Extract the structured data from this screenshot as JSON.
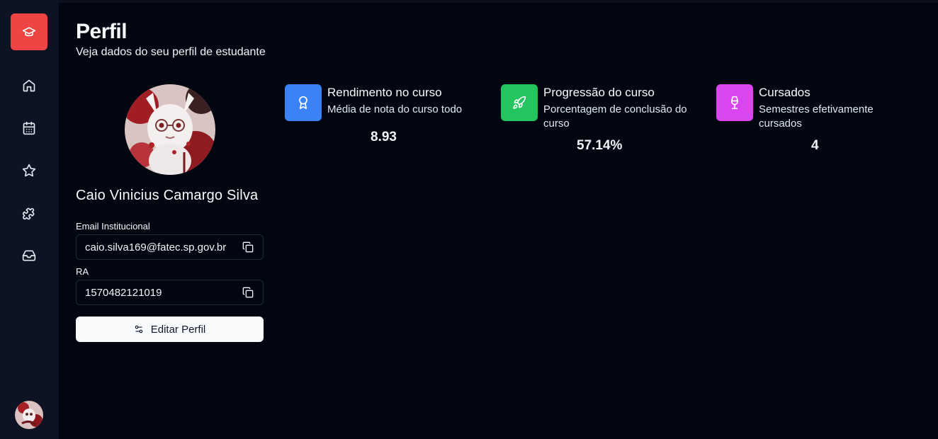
{
  "header": {
    "title": "Perfil",
    "subtitle": "Veja dados do seu perfil de estudante"
  },
  "sidebar": {
    "brand_icon": "graduation-cap-icon",
    "items": [
      {
        "icon": "home-icon"
      },
      {
        "icon": "calendar-icon"
      },
      {
        "icon": "star-icon"
      },
      {
        "icon": "puzzle-icon"
      },
      {
        "icon": "inbox-icon"
      }
    ]
  },
  "profile": {
    "name": "Caio Vinicius Camargo Silva",
    "email_label": "Email Institucional",
    "email": "caio.silva169@fatec.sp.gov.br",
    "ra_label": "RA",
    "ra": "1570482121019",
    "edit_label": "Editar Perfil"
  },
  "stats": [
    {
      "title": "Rendimento no curso",
      "description": "Média de nota do curso todo",
      "value": "8.93",
      "color": "#3b82f6",
      "icon": "award-icon"
    },
    {
      "title": "Progressão do curso",
      "description": "Porcentagem de conclusão do curso",
      "value": "57.14%",
      "color": "#22c55e",
      "icon": "rocket-icon"
    },
    {
      "title": "Cursados",
      "description": "Semestres efetivamente cursados",
      "value": "4",
      "color": "#d946ef",
      "icon": "wine-glass-icon"
    }
  ],
  "colors": {
    "background": "#020611",
    "sidebar": "#0d1322",
    "brand": "#ef4444"
  }
}
